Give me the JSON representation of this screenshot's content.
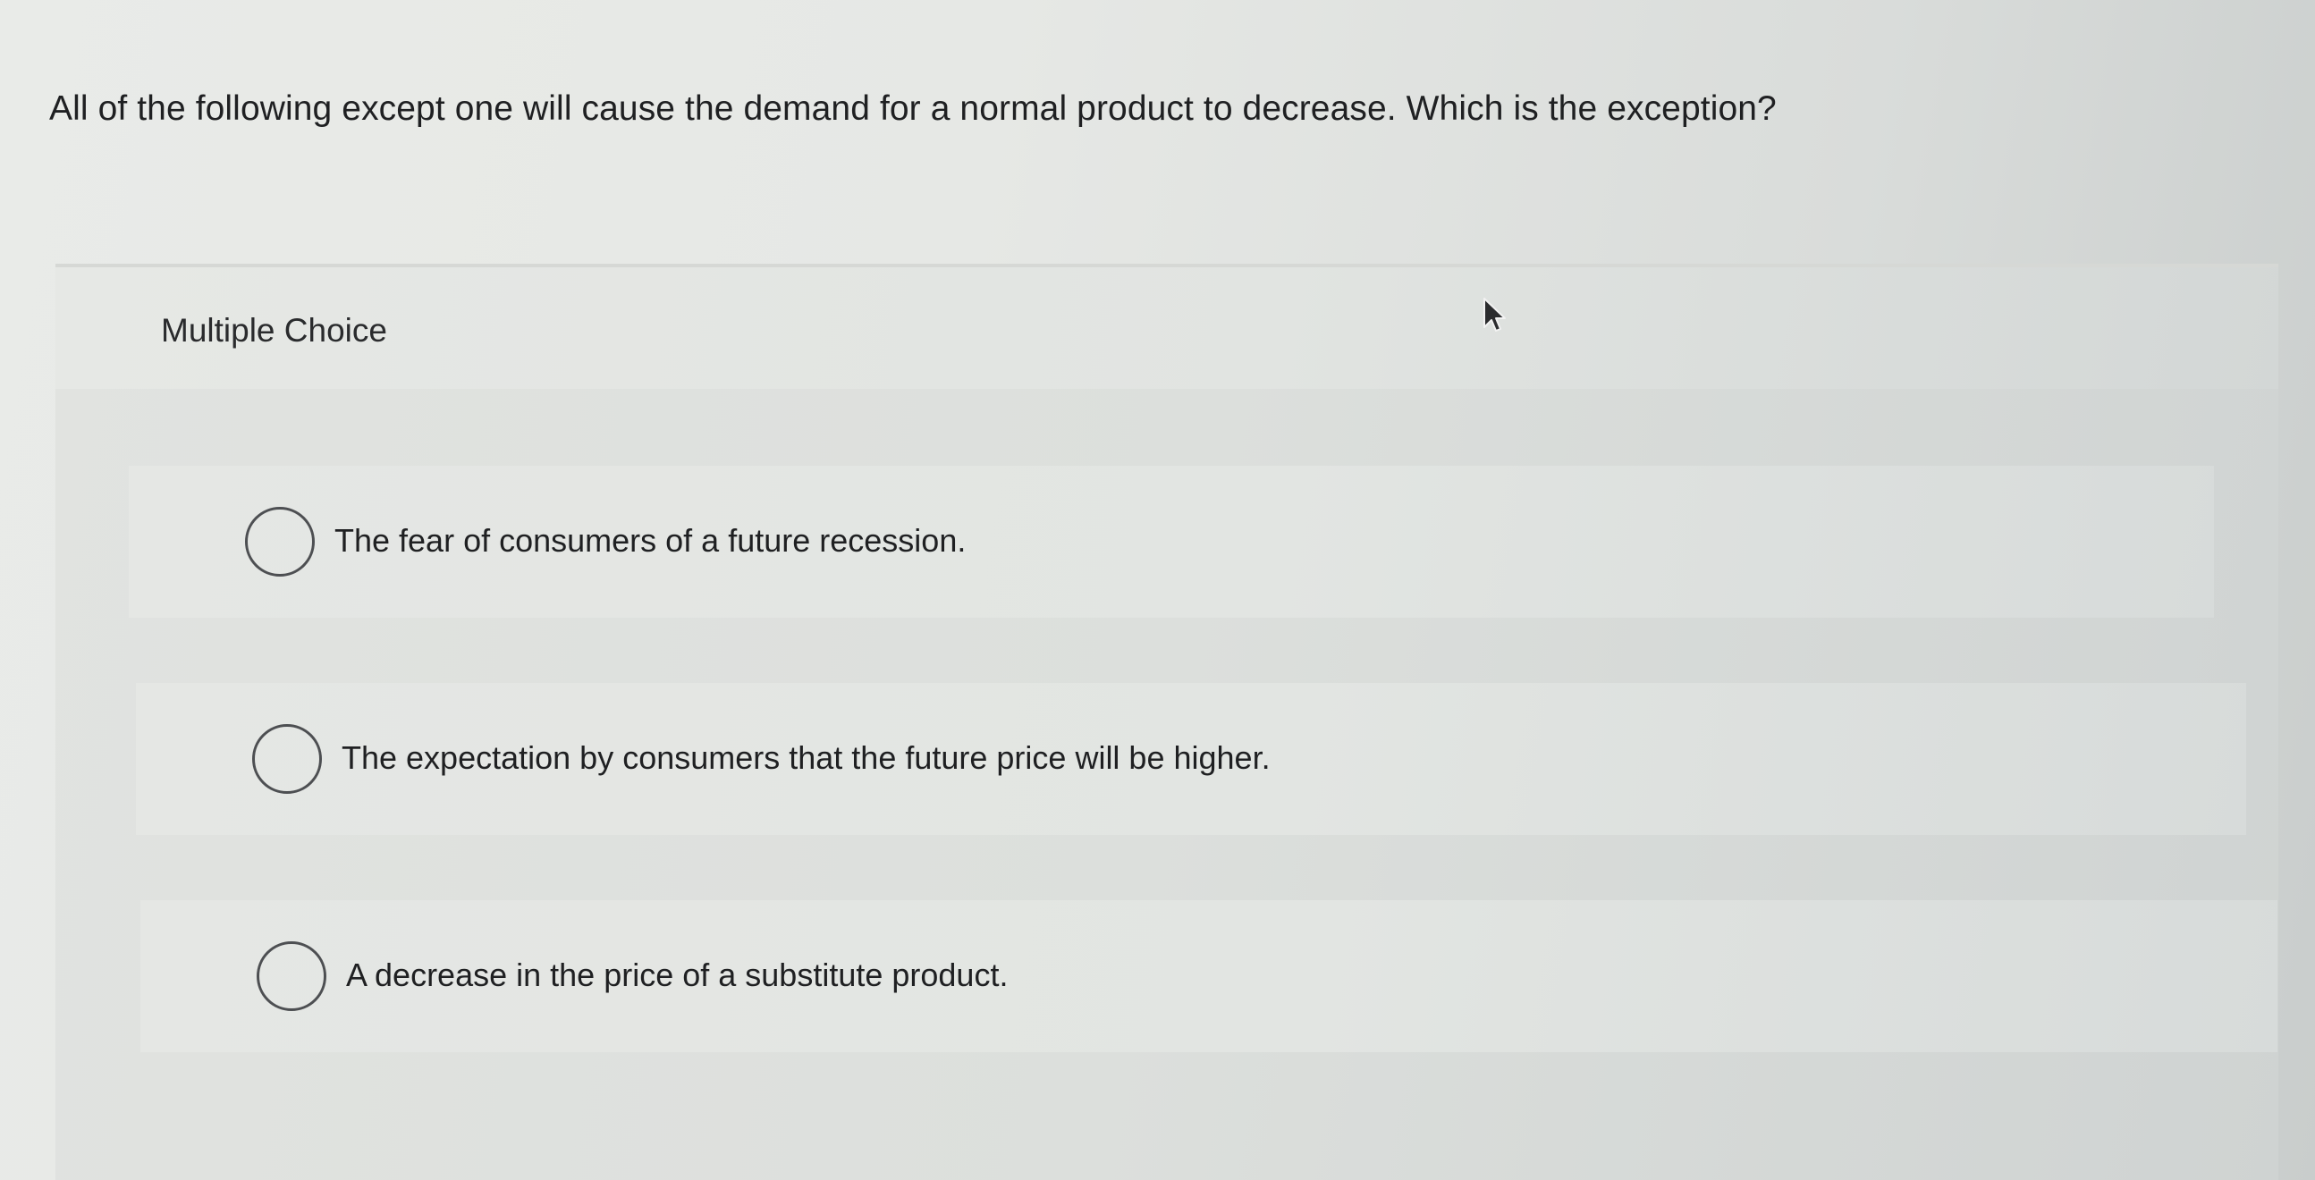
{
  "question": {
    "text": "All of the following except one will cause the demand for a normal product to decrease. Which is the exception?"
  },
  "multiple_choice": {
    "label": "Multiple Choice",
    "options": [
      {
        "text": "The fear of consumers of a future recession.",
        "selected": false
      },
      {
        "text": "The expectation by consumers that the future price will be higher.",
        "selected": false
      },
      {
        "text": "A decrease in the price of a substitute product.",
        "selected": false
      }
    ]
  },
  "icons": {
    "radio": "radio-unselected-icon",
    "cursor": "mouse-pointer-icon"
  },
  "colors": {
    "background": "#e6e8e5",
    "panel": "#dcdfdc",
    "text": "#1f2022",
    "radio_border": "#4d4f52"
  }
}
